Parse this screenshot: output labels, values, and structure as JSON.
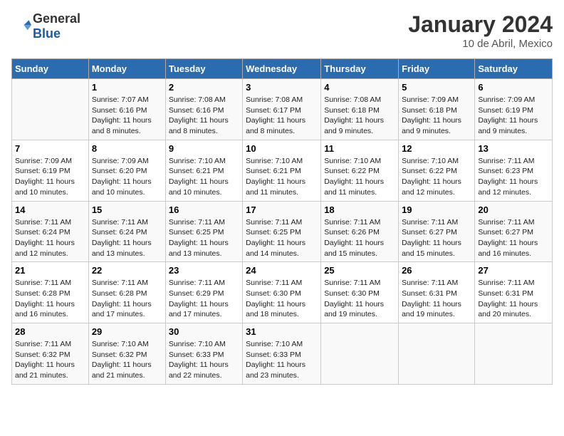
{
  "header": {
    "logo_general": "General",
    "logo_blue": "Blue",
    "title": "January 2024",
    "subtitle": "10 de Abril, Mexico"
  },
  "days_of_week": [
    "Sunday",
    "Monday",
    "Tuesday",
    "Wednesday",
    "Thursday",
    "Friday",
    "Saturday"
  ],
  "weeks": [
    [
      {
        "day": "",
        "sunrise": "",
        "sunset": "",
        "daylight": ""
      },
      {
        "day": "1",
        "sunrise": "Sunrise: 7:07 AM",
        "sunset": "Sunset: 6:16 PM",
        "daylight": "Daylight: 11 hours and 8 minutes."
      },
      {
        "day": "2",
        "sunrise": "Sunrise: 7:08 AM",
        "sunset": "Sunset: 6:16 PM",
        "daylight": "Daylight: 11 hours and 8 minutes."
      },
      {
        "day": "3",
        "sunrise": "Sunrise: 7:08 AM",
        "sunset": "Sunset: 6:17 PM",
        "daylight": "Daylight: 11 hours and 8 minutes."
      },
      {
        "day": "4",
        "sunrise": "Sunrise: 7:08 AM",
        "sunset": "Sunset: 6:18 PM",
        "daylight": "Daylight: 11 hours and 9 minutes."
      },
      {
        "day": "5",
        "sunrise": "Sunrise: 7:09 AM",
        "sunset": "Sunset: 6:18 PM",
        "daylight": "Daylight: 11 hours and 9 minutes."
      },
      {
        "day": "6",
        "sunrise": "Sunrise: 7:09 AM",
        "sunset": "Sunset: 6:19 PM",
        "daylight": "Daylight: 11 hours and 9 minutes."
      }
    ],
    [
      {
        "day": "7",
        "sunrise": "Sunrise: 7:09 AM",
        "sunset": "Sunset: 6:19 PM",
        "daylight": "Daylight: 11 hours and 10 minutes."
      },
      {
        "day": "8",
        "sunrise": "Sunrise: 7:09 AM",
        "sunset": "Sunset: 6:20 PM",
        "daylight": "Daylight: 11 hours and 10 minutes."
      },
      {
        "day": "9",
        "sunrise": "Sunrise: 7:10 AM",
        "sunset": "Sunset: 6:21 PM",
        "daylight": "Daylight: 11 hours and 10 minutes."
      },
      {
        "day": "10",
        "sunrise": "Sunrise: 7:10 AM",
        "sunset": "Sunset: 6:21 PM",
        "daylight": "Daylight: 11 hours and 11 minutes."
      },
      {
        "day": "11",
        "sunrise": "Sunrise: 7:10 AM",
        "sunset": "Sunset: 6:22 PM",
        "daylight": "Daylight: 11 hours and 11 minutes."
      },
      {
        "day": "12",
        "sunrise": "Sunrise: 7:10 AM",
        "sunset": "Sunset: 6:22 PM",
        "daylight": "Daylight: 11 hours and 12 minutes."
      },
      {
        "day": "13",
        "sunrise": "Sunrise: 7:11 AM",
        "sunset": "Sunset: 6:23 PM",
        "daylight": "Daylight: 11 hours and 12 minutes."
      }
    ],
    [
      {
        "day": "14",
        "sunrise": "Sunrise: 7:11 AM",
        "sunset": "Sunset: 6:24 PM",
        "daylight": "Daylight: 11 hours and 12 minutes."
      },
      {
        "day": "15",
        "sunrise": "Sunrise: 7:11 AM",
        "sunset": "Sunset: 6:24 PM",
        "daylight": "Daylight: 11 hours and 13 minutes."
      },
      {
        "day": "16",
        "sunrise": "Sunrise: 7:11 AM",
        "sunset": "Sunset: 6:25 PM",
        "daylight": "Daylight: 11 hours and 13 minutes."
      },
      {
        "day": "17",
        "sunrise": "Sunrise: 7:11 AM",
        "sunset": "Sunset: 6:25 PM",
        "daylight": "Daylight: 11 hours and 14 minutes."
      },
      {
        "day": "18",
        "sunrise": "Sunrise: 7:11 AM",
        "sunset": "Sunset: 6:26 PM",
        "daylight": "Daylight: 11 hours and 15 minutes."
      },
      {
        "day": "19",
        "sunrise": "Sunrise: 7:11 AM",
        "sunset": "Sunset: 6:27 PM",
        "daylight": "Daylight: 11 hours and 15 minutes."
      },
      {
        "day": "20",
        "sunrise": "Sunrise: 7:11 AM",
        "sunset": "Sunset: 6:27 PM",
        "daylight": "Daylight: 11 hours and 16 minutes."
      }
    ],
    [
      {
        "day": "21",
        "sunrise": "Sunrise: 7:11 AM",
        "sunset": "Sunset: 6:28 PM",
        "daylight": "Daylight: 11 hours and 16 minutes."
      },
      {
        "day": "22",
        "sunrise": "Sunrise: 7:11 AM",
        "sunset": "Sunset: 6:28 PM",
        "daylight": "Daylight: 11 hours and 17 minutes."
      },
      {
        "day": "23",
        "sunrise": "Sunrise: 7:11 AM",
        "sunset": "Sunset: 6:29 PM",
        "daylight": "Daylight: 11 hours and 17 minutes."
      },
      {
        "day": "24",
        "sunrise": "Sunrise: 7:11 AM",
        "sunset": "Sunset: 6:30 PM",
        "daylight": "Daylight: 11 hours and 18 minutes."
      },
      {
        "day": "25",
        "sunrise": "Sunrise: 7:11 AM",
        "sunset": "Sunset: 6:30 PM",
        "daylight": "Daylight: 11 hours and 19 minutes."
      },
      {
        "day": "26",
        "sunrise": "Sunrise: 7:11 AM",
        "sunset": "Sunset: 6:31 PM",
        "daylight": "Daylight: 11 hours and 19 minutes."
      },
      {
        "day": "27",
        "sunrise": "Sunrise: 7:11 AM",
        "sunset": "Sunset: 6:31 PM",
        "daylight": "Daylight: 11 hours and 20 minutes."
      }
    ],
    [
      {
        "day": "28",
        "sunrise": "Sunrise: 7:11 AM",
        "sunset": "Sunset: 6:32 PM",
        "daylight": "Daylight: 11 hours and 21 minutes."
      },
      {
        "day": "29",
        "sunrise": "Sunrise: 7:10 AM",
        "sunset": "Sunset: 6:32 PM",
        "daylight": "Daylight: 11 hours and 21 minutes."
      },
      {
        "day": "30",
        "sunrise": "Sunrise: 7:10 AM",
        "sunset": "Sunset: 6:33 PM",
        "daylight": "Daylight: 11 hours and 22 minutes."
      },
      {
        "day": "31",
        "sunrise": "Sunrise: 7:10 AM",
        "sunset": "Sunset: 6:33 PM",
        "daylight": "Daylight: 11 hours and 23 minutes."
      },
      {
        "day": "",
        "sunrise": "",
        "sunset": "",
        "daylight": ""
      },
      {
        "day": "",
        "sunrise": "",
        "sunset": "",
        "daylight": ""
      },
      {
        "day": "",
        "sunrise": "",
        "sunset": "",
        "daylight": ""
      }
    ]
  ]
}
